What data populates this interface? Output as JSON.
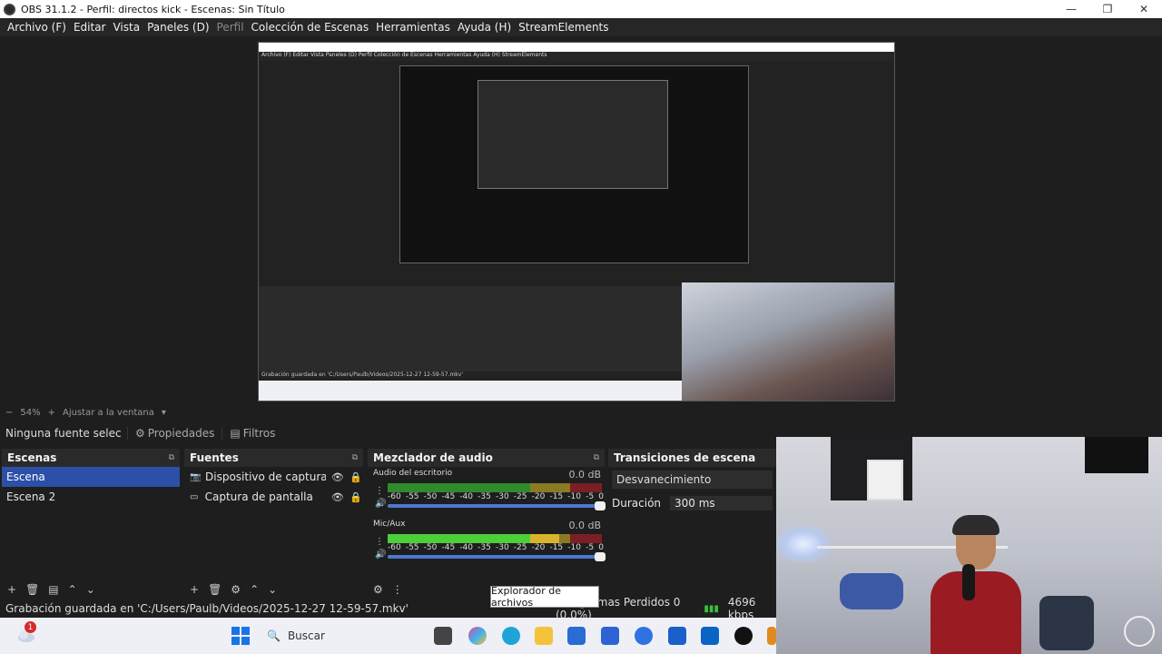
{
  "window": {
    "title": "OBS 31.1.2 - Perfil: directos kick - Escenas: Sin Título",
    "controls": [
      "—",
      "❐",
      "✕"
    ]
  },
  "menu": [
    {
      "label": "Archivo (F)",
      "enabled": true
    },
    {
      "label": "Editar",
      "enabled": true
    },
    {
      "label": "Vista",
      "enabled": true
    },
    {
      "label": "Paneles (D)",
      "enabled": true
    },
    {
      "label": "Perfil",
      "enabled": false
    },
    {
      "label": "Colección de Escenas",
      "enabled": true
    },
    {
      "label": "Herramientas",
      "enabled": true
    },
    {
      "label": "Ayuda (H)",
      "enabled": true
    },
    {
      "label": "StreamElements",
      "enabled": true
    }
  ],
  "zoom": {
    "minus": "−",
    "value": "54%",
    "plus": "+",
    "fit": "Ajustar a la ventana",
    "caret": "▾"
  },
  "source_bar": {
    "no_source": "Ninguna fuente selec",
    "properties": "Propiedades",
    "filters": "Filtros"
  },
  "scenes": {
    "title": "Escenas",
    "items": [
      {
        "label": "Escena",
        "selected": true
      },
      {
        "label": "Escena 2",
        "selected": false
      }
    ]
  },
  "sources": {
    "title": "Fuentes",
    "items": [
      {
        "label": "Dispositivo de captura de v"
      },
      {
        "label": "Captura de pantalla"
      }
    ]
  },
  "mixer": {
    "title": "Mezclador de audio",
    "scale": [
      "-60",
      "-55",
      "-50",
      "-45",
      "-40",
      "-35",
      "-30",
      "-25",
      "-20",
      "-15",
      "-10",
      "-5",
      "0"
    ],
    "tracks": [
      {
        "name": "Audio del escritorio",
        "db": "0.0 dB",
        "level": 0.0,
        "volume": 1.0
      },
      {
        "name": "Mic/Aux",
        "db": "0.0 dB",
        "level": 0.8,
        "volume": 1.0
      }
    ]
  },
  "transitions": {
    "title": "Transiciones de escena",
    "selected": "Desvanecimiento",
    "duration_label": "Duración",
    "duration_value": "300 ms"
  },
  "status": {
    "recording_saved": "Grabación guardada en 'C:/Users/Paulb/Videos/2025-12-27 12-59-57.mkv'",
    "frames_dropped": "Fotogramas Perdidos 0 (0.0%)",
    "bitrate": "4696 kbps"
  },
  "tooltip": "Explorador de archivos",
  "taskbar": {
    "notification_count": "1",
    "search_placeholder": "Buscar"
  },
  "nested_preview": {
    "menu_text": "Archivo (F)   Editar   Vista   Paneles (D)   Perfil   Colección de Escenas   Herramientas   Ayuda (H)   StreamElements",
    "status_text": "Grabación guardada en 'C:/Users/Paulb/Videos/2025-12-27 12-59-57.mkv'"
  },
  "colors": {
    "accent": "#2c4fa8",
    "meter_green": "#2e8b2e",
    "meter_green_active": "#4ccf3a",
    "meter_yellow": "#8a7a22",
    "meter_yellow_active": "#d9b42a",
    "meter_red": "#7a1f24"
  }
}
